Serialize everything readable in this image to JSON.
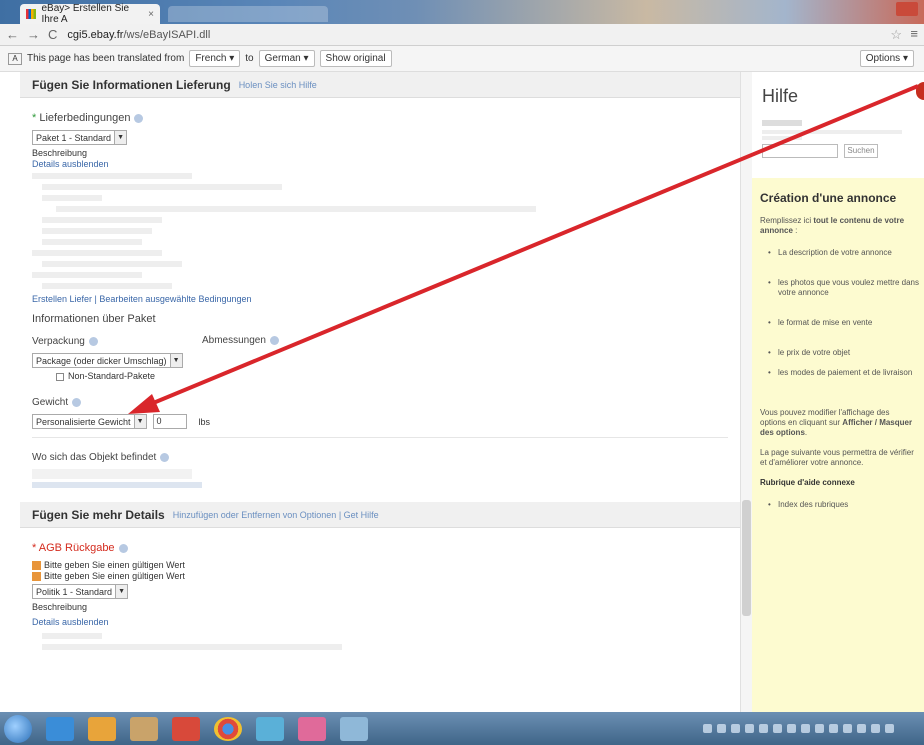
{
  "tab": {
    "title": "eBay> Erstellen Sie Ihre A",
    "close": "×"
  },
  "address": {
    "host": "cgi5.ebay.fr",
    "path": "/ws/eBayISAPI.dll"
  },
  "translate_bar": {
    "message": "This page has been translated from",
    "from_lang": "French",
    "to_label": "to",
    "to_lang": "German",
    "show_original": "Show original",
    "options": "Options"
  },
  "shipping_section": {
    "title": "Fügen Sie Informationen Lieferung",
    "help_link": "Holen Sie sich Hilfe",
    "delivery_label": "Lieferbedingungen",
    "delivery_select": "Paket 1 - Standard",
    "description_label": "Beschreibung",
    "details_link": "Details ausblenden",
    "edit_links": "Erstellen Liefer | Bearbeiten ausgewählte Bedingungen",
    "package_info_label": "Informationen über Paket",
    "packaging_label": "Verpackung",
    "dimensions_label": "Abmessungen",
    "packaging_select": "Package (oder dicker Umschlag)",
    "nonstandard_label": "Non-Standard-Pakete",
    "weight_label": "Gewicht",
    "weight_select": "Personalisierte Gewicht",
    "weight_value": "0",
    "weight_unit": "lbs",
    "location_label": "Wo sich das Objekt befindet"
  },
  "details_section": {
    "title": "Fügen Sie mehr Details",
    "links": "Hinzufügen oder Entfernen von Optionen | Get Hilfe",
    "returns_label": "AGB Rückgabe",
    "error_1": "Bitte geben Sie einen gültigen Wert",
    "error_2": "Bitte geben Sie einen gültigen Wert",
    "returns_select": "Politik 1 - Standard",
    "description_label": "Beschreibung",
    "details_link": "Details ausblenden"
  },
  "help": {
    "title": "Hilfe",
    "search_button": "Suchen",
    "article_title": "Création d'une annonce",
    "intro_pre": "Remplissez ici",
    "intro_bold": "tout le contenu de votre annonce",
    "items": [
      "La description de votre annonce",
      "les photos que vous voulez mettre dans votre annonce",
      "le format de mise en vente",
      "le prix de votre objet",
      "les modes de paiement et de livraison"
    ],
    "options_text_pre": "Vous pouvez modifier l'affichage des options en cliquant sur",
    "options_bold": "Afficher / Masquer des options",
    "next_text": "La page suivante vous permettra de vérifier et d'améliorer votre annonce.",
    "rubric_title": "Rubrique d'aide connexe",
    "rubric_items": [
      "Index des rubriques"
    ]
  },
  "colors": {
    "annotation_arrow": "#d9262b",
    "help_panel": "#fdfbd0",
    "link": "#3a67a8"
  },
  "icons": [
    "back-icon",
    "forward-icon",
    "reload-icon",
    "star-icon",
    "menu-icon",
    "translate-icon",
    "help-icon"
  ]
}
